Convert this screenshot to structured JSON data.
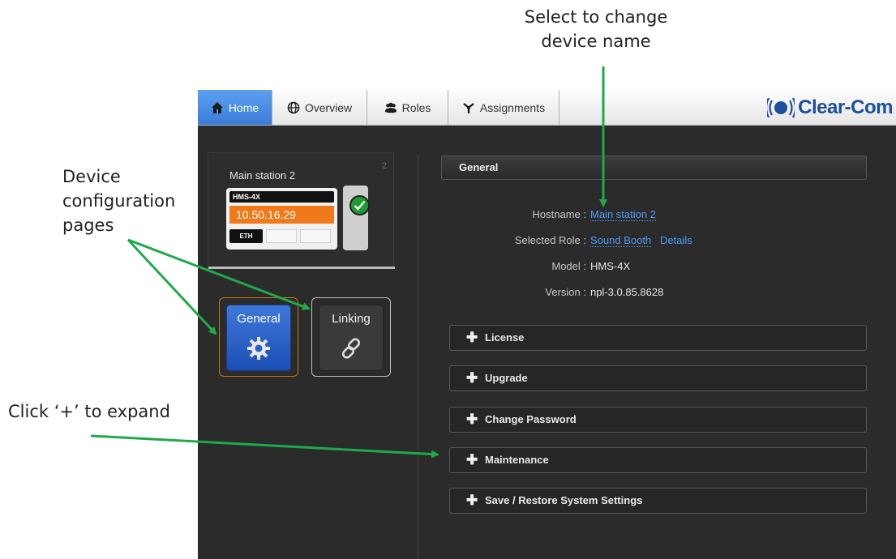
{
  "annotations": {
    "top_line1": "Select to change",
    "top_line2": "device name",
    "left_line1": "Device",
    "left_line2": "configuration",
    "left_line3": "pages",
    "expand": "Click ‘+’ to expand"
  },
  "tabs": [
    {
      "label": "Home",
      "icon": "home-icon"
    },
    {
      "label": "Overview",
      "icon": "globe-icon"
    },
    {
      "label": "Roles",
      "icon": "users-icon"
    },
    {
      "label": "Assignments",
      "icon": "assignments-icon"
    }
  ],
  "logo": {
    "text": "Clear-Com"
  },
  "device": {
    "name": "Main station 2",
    "number": "2",
    "model": "HMS-4X",
    "ip": "10.50.16.29",
    "port": "ETH",
    "status": "online"
  },
  "pages": {
    "general": "General",
    "linking": "Linking"
  },
  "general": {
    "header": "General",
    "hostname_label": "Hostname :",
    "hostname_value": "Main station 2",
    "role_label": "Selected Role :",
    "role_value": "Sound Booth",
    "role_details": "Details",
    "model_label": "Model :",
    "model_value": "HMS-4X",
    "version_label": "Version :",
    "version_value": "npl-3.0.85.8628"
  },
  "sections": [
    "License",
    "Upgrade",
    "Change Password",
    "Maintenance",
    "Save / Restore System Settings"
  ],
  "colors": {
    "accent_blue": "#3b7dd8",
    "ip_orange": "#f07a1a",
    "arrow_green": "#1faa4a",
    "link_blue": "#4f9bf7",
    "logo_blue": "#1b4fa0"
  }
}
